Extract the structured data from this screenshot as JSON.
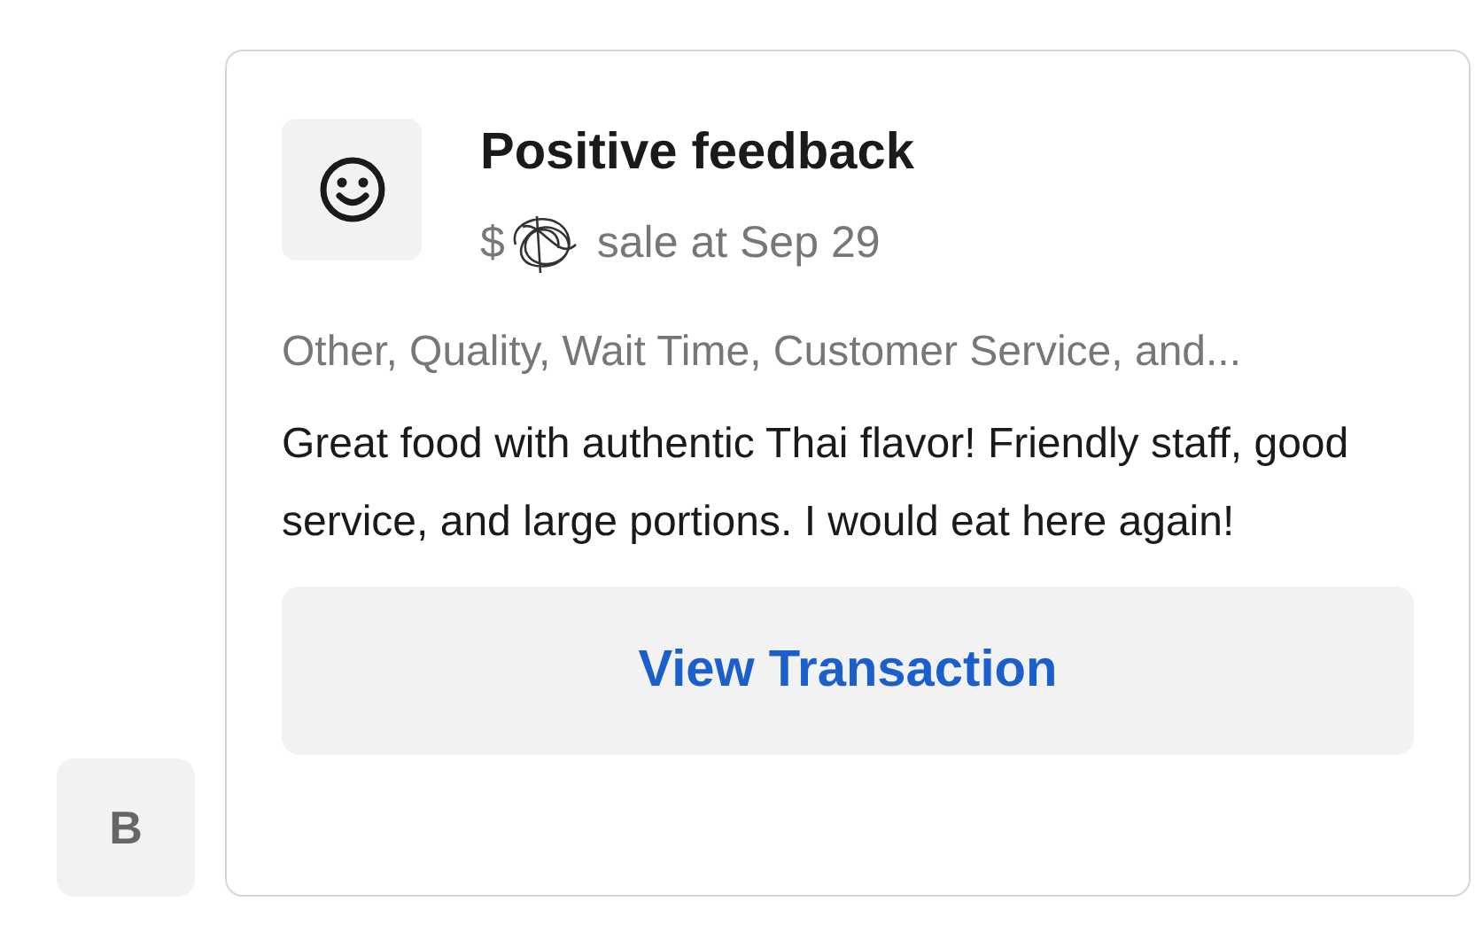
{
  "avatar": {
    "initial": "B"
  },
  "card": {
    "title": "Positive feedback",
    "amount_prefix": "$",
    "subtitle": "sale at Sep 29",
    "tags": "Other, Quality, Wait Time, Customer Service, and...",
    "message": "Great food with authentic Thai flavor! Friendly staff, good service, and large portions. I would eat here again!",
    "button": "View Transaction"
  }
}
